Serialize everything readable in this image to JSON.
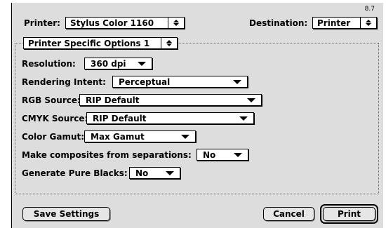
{
  "version": "8.7",
  "header": {
    "printer_label": "Printer:",
    "printer_value": "Stylus Color 1160",
    "destination_label": "Destination:",
    "destination_value": "Printer"
  },
  "panel": {
    "selected": "Printer Specific Options 1"
  },
  "options": {
    "resolution": {
      "label": "Resolution:",
      "value": "360 dpi"
    },
    "rendering_intent": {
      "label": "Rendering Intent:",
      "value": "Perceptual"
    },
    "rgb_source": {
      "label": "RGB Source:",
      "value": "RIP Default"
    },
    "cmyk_source": {
      "label": "CMYK Source:",
      "value": "RIP Default"
    },
    "color_gamut": {
      "label": "Color Gamut:",
      "value": "Max Gamut"
    },
    "composites": {
      "label": "Make composites from separations:",
      "value": "No"
    },
    "pure_blacks": {
      "label": "Generate Pure Blacks:",
      "value": "No"
    }
  },
  "buttons": {
    "save": "Save Settings",
    "cancel": "Cancel",
    "print": "Print"
  }
}
